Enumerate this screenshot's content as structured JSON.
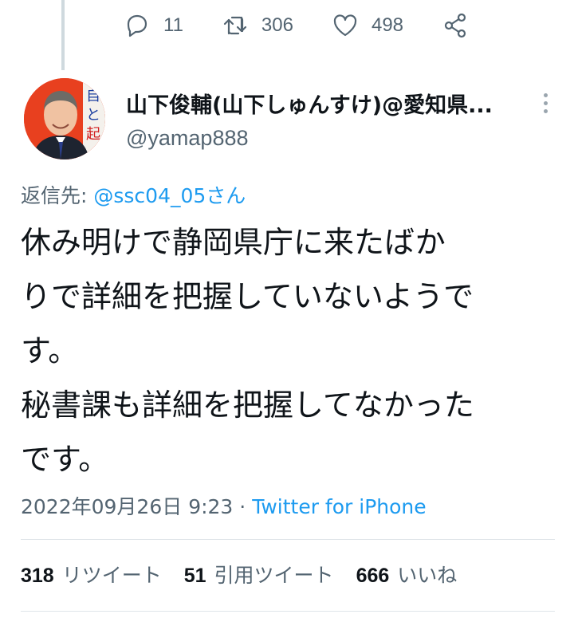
{
  "previous_tweet": {
    "replies": "11",
    "retweets": "306",
    "likes": "498"
  },
  "author": {
    "name": "山下俊輔(山下しゅんすけ)@愛知県...",
    "handle": "@yamap888"
  },
  "reply": {
    "prefix": "返信先: ",
    "mention": "@ssc04_05さん"
  },
  "tweet": {
    "lines": [
      "休み明けで静岡県庁に来たばか",
      "りで詳細を把握していないようで",
      "す。",
      "秘書課も詳細を把握してなかった",
      "です。"
    ]
  },
  "meta": {
    "timestamp": "2022年09月26日 9:23",
    "separator": " · ",
    "source": "Twitter for iPhone"
  },
  "stats": {
    "retweets_count": "318",
    "retweets_label": "リツイート",
    "quotes_count": "51",
    "quotes_label": "引用ツイート",
    "likes_count": "666",
    "likes_label": "いいね"
  },
  "icons": [
    "reply-icon",
    "retweet-icon",
    "like-icon",
    "share-icon",
    "more-options-icon",
    "avatar"
  ]
}
